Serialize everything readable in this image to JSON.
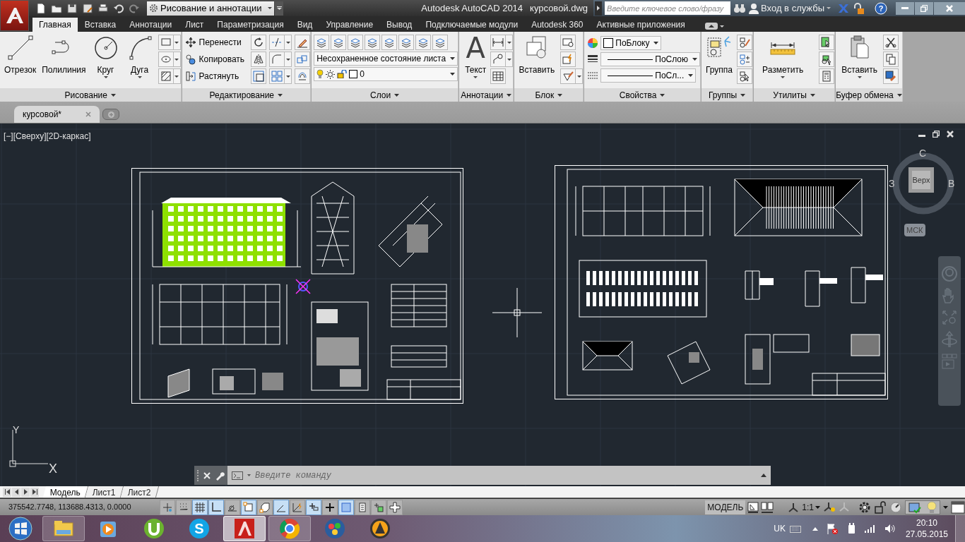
{
  "title_bar": {
    "workspace": "Рисование и аннотации",
    "app_name": "Autodesk AutoCAD 2014",
    "file_name": "курсовой.dwg",
    "search": {
      "placeholder": "Введите ключевое слово/фразу"
    },
    "sign_in": "Вход в службы",
    "help_glyph": "?"
  },
  "ribbon_tabs": [
    {
      "label": "Главная",
      "selected": true
    },
    {
      "label": "Вставка",
      "selected": false
    },
    {
      "label": "Аннотации",
      "selected": false
    },
    {
      "label": "Лист",
      "selected": false
    },
    {
      "label": "Параметризация",
      "selected": false
    },
    {
      "label": "Вид",
      "selected": false
    },
    {
      "label": "Управление",
      "selected": false
    },
    {
      "label": "Вывод",
      "selected": false
    },
    {
      "label": "Подключаемые модули",
      "selected": false
    },
    {
      "label": "Autodesk 360",
      "selected": false
    },
    {
      "label": "Активные приложения",
      "selected": false
    }
  ],
  "panels": [
    {
      "kind": "draw",
      "title": "Рисование",
      "tools": [
        {
          "label": "Отрезок"
        },
        {
          "label": "Полилиния"
        },
        {
          "label": "Круг"
        },
        {
          "label": "Дуга"
        }
      ]
    },
    {
      "kind": "modify",
      "title": "Редактирование",
      "tools": [
        {
          "label": "Перенести"
        },
        {
          "label": "Копировать"
        },
        {
          "label": "Растянуть"
        }
      ]
    },
    {
      "kind": "layers",
      "title": "Слои",
      "combos": [
        {
          "value": "Несохраненное состояние листа"
        },
        {
          "value": "0"
        }
      ]
    },
    {
      "kind": "annotation",
      "title": "Аннотации",
      "glyph": "A",
      "tools": [
        {
          "label": "Текст"
        }
      ]
    },
    {
      "kind": "block",
      "title": "Блок",
      "tools": [
        {
          "label": "Вставить"
        }
      ]
    },
    {
      "kind": "properties",
      "title": "Свойства",
      "combos": [
        {
          "value": "ПоБлоку"
        },
        {
          "value": "ПоСлою"
        },
        {
          "value": "ПоСл..."
        }
      ]
    },
    {
      "kind": "groups",
      "title": "Группы",
      "tools": [
        {
          "label": "Группа"
        }
      ]
    },
    {
      "kind": "utilities",
      "title": "Утилиты",
      "tools": [
        {
          "label": "Разметить"
        }
      ]
    },
    {
      "kind": "clipboard",
      "title": "Буфер обмена",
      "tools": [
        {
          "label": "Вставить"
        }
      ]
    }
  ],
  "document_tabs": [
    {
      "label": "курсовой*",
      "selected": true
    }
  ],
  "viewport": {
    "label": "[−][Сверху][2D-каркас]",
    "viewcube": {
      "north": "С",
      "west": "З",
      "east": "В",
      "face": "Верх",
      "ucs": "МСК"
    },
    "axis_y": "Y",
    "axis_x": "X"
  },
  "command_line": {
    "placeholder": "Введите команду"
  },
  "layout_tabs": [
    {
      "label": "Модель",
      "selected": true
    },
    {
      "label": "Лист1",
      "selected": false
    },
    {
      "label": "Лист2",
      "selected": false
    }
  ],
  "status_bar": {
    "coordinates": "375542.7748, 113688.4313, 0.0000",
    "toggles": [
      {
        "on": false
      },
      {
        "on": false
      },
      {
        "on": true
      },
      {
        "on": true
      },
      {
        "on": false
      },
      {
        "on": true
      },
      {
        "on": false
      },
      {
        "on": true
      },
      {
        "on": false
      },
      {
        "on": true
      },
      {
        "on": false
      },
      {
        "on": true
      },
      {
        "on": false
      },
      {
        "on": false
      },
      {
        "on": false
      }
    ],
    "space": "МОДЕЛЬ",
    "scale": "1:1"
  },
  "taskbar": {
    "apps": [
      {
        "kind": "folder",
        "selected": false
      },
      {
        "kind": "player",
        "selected": false
      },
      {
        "kind": "torrent",
        "selected": false
      },
      {
        "kind": "skype",
        "selected": false,
        "glyph": "S"
      },
      {
        "kind": "autocad",
        "selected": true
      },
      {
        "kind": "chrome",
        "selected": false
      },
      {
        "kind": "balls",
        "selected": false
      },
      {
        "kind": "aimp",
        "selected": false
      }
    ],
    "language": "UK",
    "time": "20:10",
    "date": "27.05.2015"
  }
}
